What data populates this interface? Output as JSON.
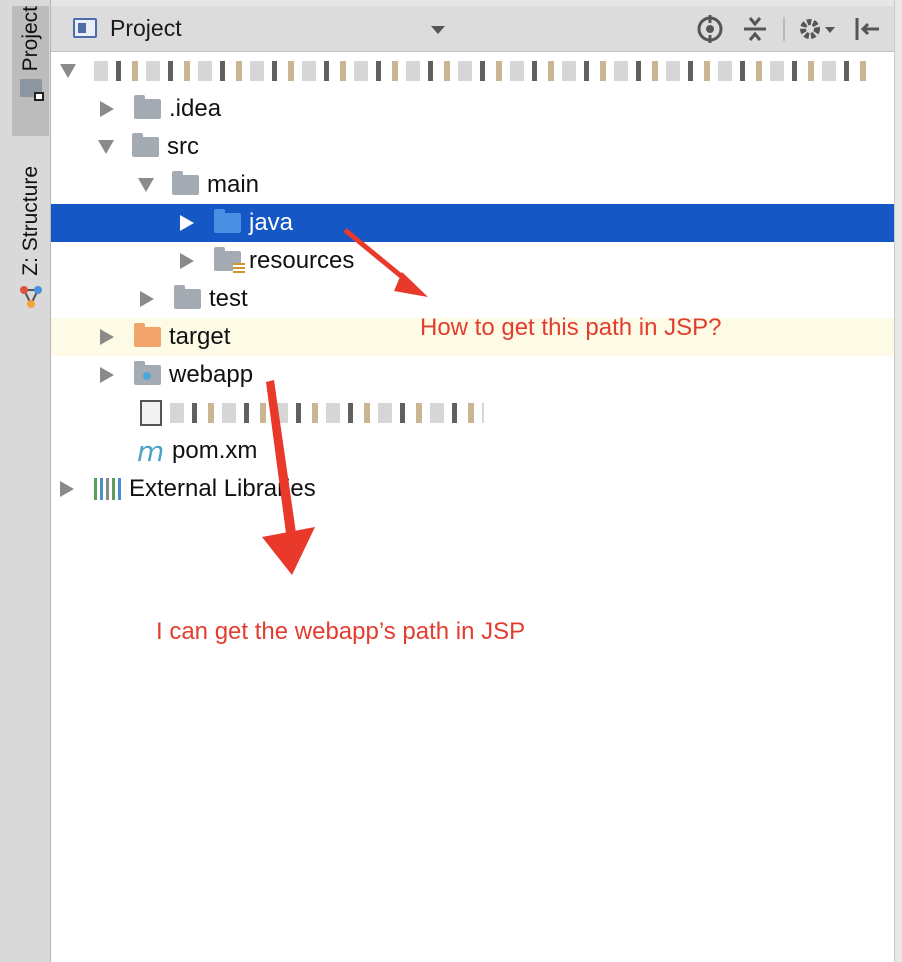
{
  "toolwindow_tabs": [
    {
      "label": "Project"
    },
    {
      "label": "Z: Structure"
    }
  ],
  "header": {
    "title": "Project"
  },
  "tree": {
    "root_label": "",
    "items": [
      {
        "label": ".idea"
      },
      {
        "label": "src"
      },
      {
        "label": "main"
      },
      {
        "label": "java"
      },
      {
        "label": "resources"
      },
      {
        "label": "test"
      },
      {
        "label": "target"
      },
      {
        "label": "webapp"
      },
      {
        "label": "pom.xm"
      },
      {
        "label": "External Libraries"
      }
    ]
  },
  "annotations": {
    "java_note": "How to get this path in JSP?",
    "webapp_note": "I can get the webapp’s path in JSP"
  },
  "colors": {
    "selection": "#1557c4",
    "annotation": "#e23d2e"
  }
}
